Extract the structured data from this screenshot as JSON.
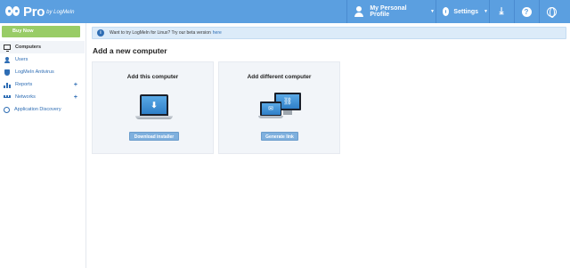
{
  "header": {
    "logo_text": "Pro",
    "logo_sub": "by LogMeIn",
    "profile_label": "My Personal Profile",
    "settings_label": "Settings",
    "download_icon": "download-icon",
    "help_icon": "help-icon",
    "help_glyph": "?",
    "globe_icon": "globe-icon",
    "brand_color": "#5b9fe0"
  },
  "sidebar": {
    "buy_now": "Buy Now",
    "items": [
      {
        "label": "Computers",
        "icon": "monitor-icon",
        "active": true
      },
      {
        "label": "Users",
        "icon": "user-icon"
      },
      {
        "label": "LogMeIn Antivirus",
        "icon": "shield-icon"
      },
      {
        "label": "Reports",
        "icon": "bar-chart-icon",
        "expandable": true
      },
      {
        "label": "Networks",
        "icon": "network-icon",
        "expandable": true
      },
      {
        "label": "Application Discovery",
        "icon": "discovery-icon"
      }
    ],
    "expand_glyph": "+"
  },
  "banner": {
    "text": "Want to try LogMeIn for Linux? Try our beta version",
    "link": "here",
    "info_glyph": "i"
  },
  "main": {
    "title": "Add a new computer",
    "cards": [
      {
        "title": "Add this computer",
        "button": "Download installer"
      },
      {
        "title": "Add different computer",
        "button": "Generate link"
      }
    ]
  }
}
